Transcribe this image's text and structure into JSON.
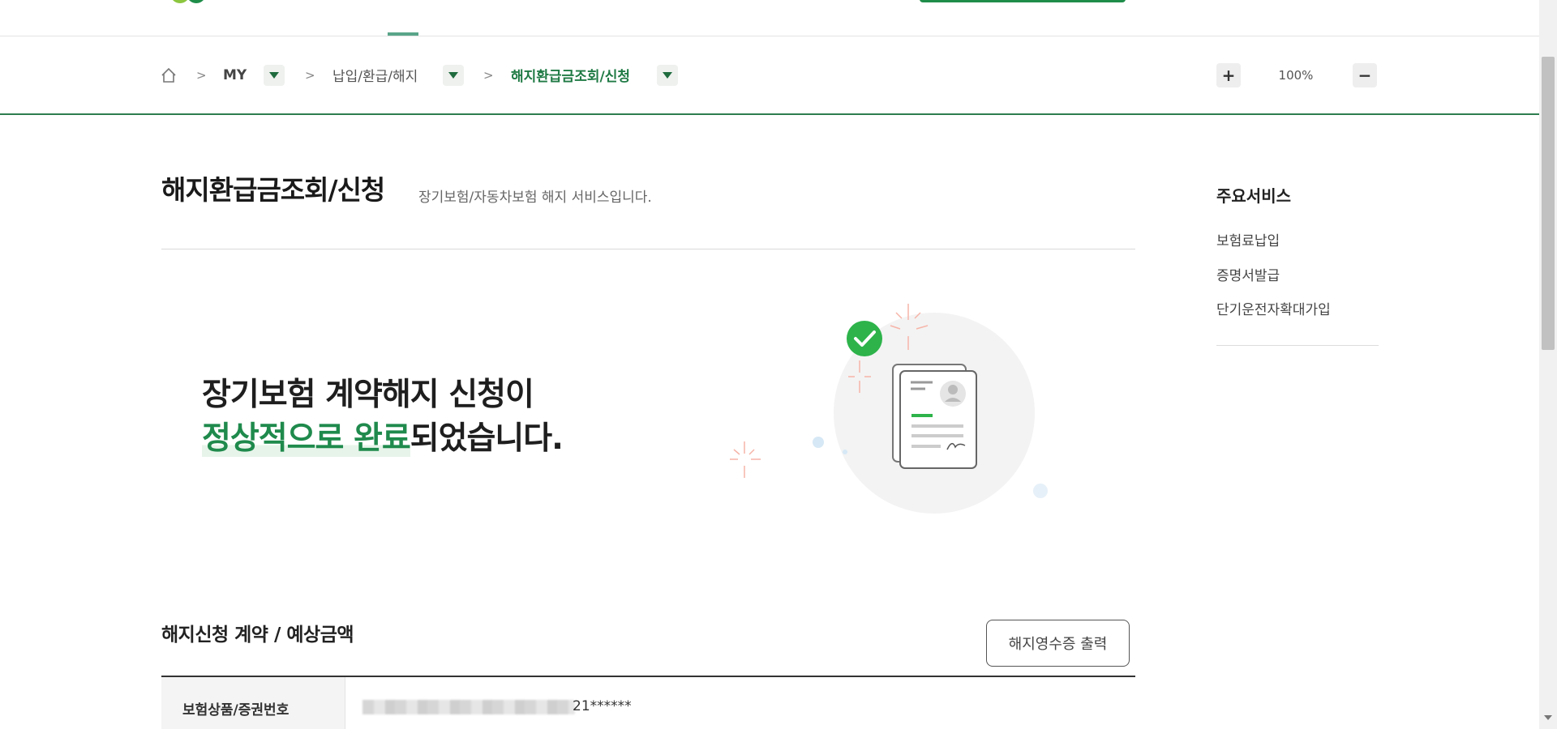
{
  "breadcrumb": {
    "items": [
      {
        "label": "MY"
      },
      {
        "label": "납입/환급/해지"
      },
      {
        "label": "해지환급금조회/신청"
      }
    ],
    "separator": ">"
  },
  "zoom": {
    "level": "100%",
    "plus": "+",
    "minus": "−"
  },
  "page": {
    "title": "해지환급금조회/신청",
    "description": "장기보험/자동차보험 해지 서비스입니다."
  },
  "completion": {
    "line1": "장기보험 계약해지 신청이",
    "line2_highlight": "정상적으로 완료",
    "line2_rest": "되었습니다."
  },
  "sidebar": {
    "title": "주요서비스",
    "items": [
      {
        "label": "보험료납입"
      },
      {
        "label": "증명서발급"
      },
      {
        "label": "단기운전자확대가입"
      }
    ]
  },
  "section": {
    "title": "해지신청 계약 / 예상금액",
    "receipt_button": "해지영수증 출력"
  },
  "table": {
    "rows": [
      {
        "header": "보험상품/증권번호",
        "value": "21******"
      }
    ]
  },
  "colors": {
    "brand_green": "#1f8a4c",
    "accent_line": "#2e7d4f"
  }
}
